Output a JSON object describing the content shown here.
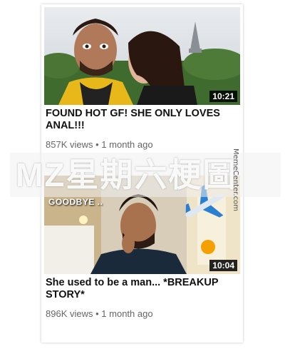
{
  "videos": [
    {
      "title": "FOUND HOT GF! SHE ONLY LOVES ANAL!!!",
      "views": "857K views",
      "age": "1 month ago",
      "duration": "10:21"
    },
    {
      "title": "She used to be a man... *BREAKUP STORY*",
      "views": "896K views",
      "age": "1 month ago",
      "duration": "10:04",
      "overlay_text": "GOODBYE .."
    }
  ],
  "separator": "•",
  "watermark": "MZ星期六梗圖",
  "side_watermark": "MemeCenter.com",
  "colors": {
    "meta_text": "#666666",
    "title_text": "#111111",
    "duration_bg": "#000000"
  }
}
